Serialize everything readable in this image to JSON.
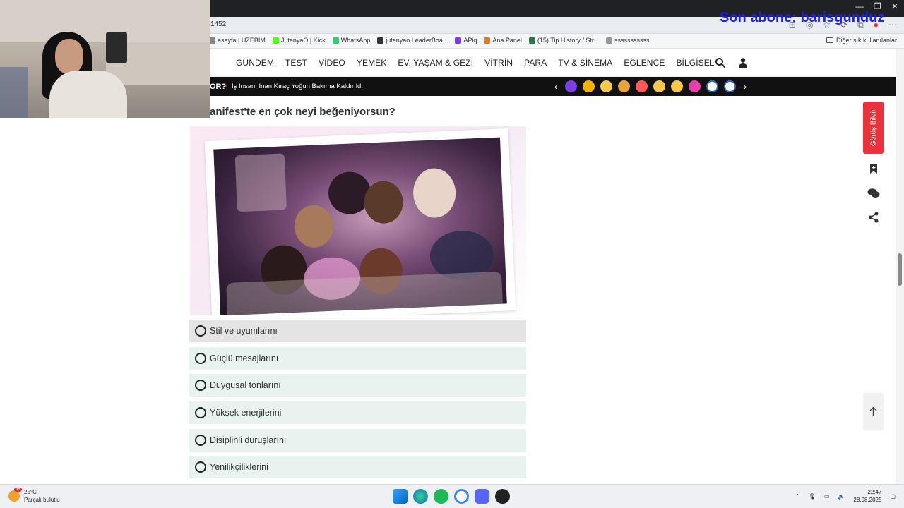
{
  "browser": {
    "url_fragment": "1452",
    "bookmarks": [
      {
        "label": "asayfa | UZEBIM",
        "color": "#888"
      },
      {
        "label": "JutenyaO | Kick",
        "color": "#53fc18"
      },
      {
        "label": "WhatsApp",
        "color": "#25d366"
      },
      {
        "label": "jutenyao LeaderBoa...",
        "color": "#333"
      },
      {
        "label": "APiq",
        "color": "#7b3fe4"
      },
      {
        "label": "Ana Panel",
        "color": "#e07b28"
      },
      {
        "label": "(15) Tip History / Str...",
        "color": "#2a7a3a"
      },
      {
        "label": "sssssssssss",
        "color": "#999"
      }
    ],
    "other_bookmarks": "Diğer sık kullanılanlar"
  },
  "nav": {
    "items": [
      "GÜNDEM",
      "TEST",
      "VİDEO",
      "YEMEK",
      "EV, YAŞAM & GEZİ",
      "VİTRİN",
      "PARA",
      "TV & SİNEMA",
      "EĞLENCE",
      "BİLGİSEL"
    ]
  },
  "ticker": {
    "label": "OR?",
    "headline": "İş İnsanı İnan Kıraç Yoğun Bakıma Kaldırıldı",
    "emoji_colors": [
      "#7b3fe4",
      "#f0b400",
      "#f2c94c",
      "#e8a33a",
      "#ff5a5a",
      "#f5c84c",
      "#f5c84c",
      "#e83fa8",
      "#ffffff",
      "#ffffff"
    ]
  },
  "quiz": {
    "question": "anifest'te en çok neyi beğeniyorsun?",
    "options": [
      "Stil ve uyumlarını",
      "Güçlü mesajlarını",
      "Duygusal tonlarını",
      "Yüksek enerjilerini",
      "Disiplinli duruşlarını",
      "Yenilikçiliklerini"
    ]
  },
  "rail": {
    "feedback_label": "Görüş Bildir"
  },
  "overlay": {
    "text": "Son abone: barisgunduz"
  },
  "taskbar": {
    "weather_badge": "9+",
    "temperature": "25°C",
    "condition": "Parçalı bulutlu",
    "time": "22:47",
    "date": "28.08.2025"
  }
}
